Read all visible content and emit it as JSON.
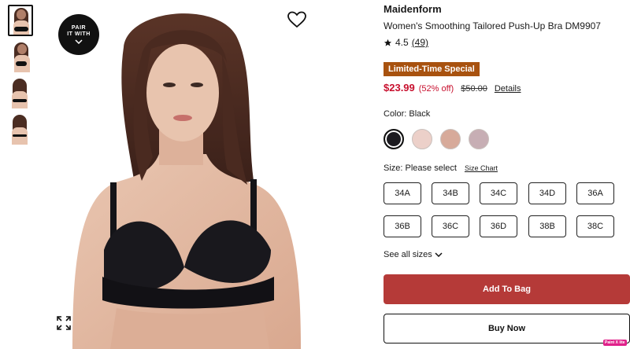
{
  "gallery": {
    "pair_badge": {
      "line1": "PAIR",
      "line2": "IT WITH"
    },
    "thumbnail_count": 4
  },
  "product": {
    "brand": "Maidenform",
    "title": "Women's Smoothing Tailored Push-Up Bra DM9907",
    "rating_value": "4.5",
    "rating_count": "(49)",
    "promo_badge": "Limited-Time Special",
    "price_sale": "$23.99",
    "price_percent": "(52% off)",
    "price_original": "$50.00",
    "details_link": "Details"
  },
  "color": {
    "label": "Color: Black",
    "swatches": [
      {
        "name": "black",
        "hex": "#1c1b20",
        "selected": true
      },
      {
        "name": "blush",
        "hex": "#ecd0c9",
        "selected": false
      },
      {
        "name": "nude",
        "hex": "#d7aa9a",
        "selected": false
      },
      {
        "name": "mauve",
        "hex": "#c7aeb4",
        "selected": false
      }
    ]
  },
  "size": {
    "label": "Size: Please select",
    "chart_link": "Size Chart",
    "options": [
      "34A",
      "34B",
      "34C",
      "34D",
      "36A",
      "36B",
      "36C",
      "36D",
      "38B",
      "38C"
    ],
    "see_all": "See all sizes"
  },
  "actions": {
    "add_to_bag": "Add To Bag",
    "buy_now": "Buy Now"
  },
  "overlay": {
    "paint_tag": "Paint X lite"
  },
  "colors": {
    "accent_red": "#b53a38",
    "promo_bg": "#a8520f",
    "sale_red": "#c8102e"
  }
}
